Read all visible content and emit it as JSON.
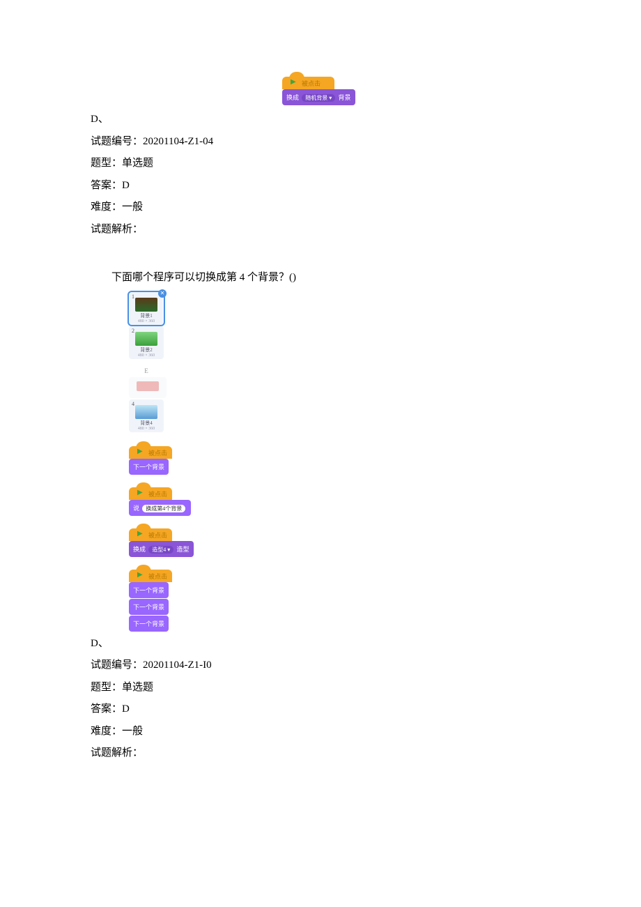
{
  "q1": {
    "block_d_hat_flag": "▶",
    "block_d_hat_text": "被点击",
    "block_d_body": "换成",
    "block_d_dd": "随机背景 ▾",
    "block_d_suffix": "背景",
    "option_d_label": "D、",
    "id_label": "试题编号：",
    "id_value": "20201104-Z1-04",
    "type_label": "题型：",
    "type_value": "单选题",
    "answer_label": "答案：",
    "answer_value": "D",
    "difficulty_label": "难度：",
    "difficulty_value": "一般",
    "analysis_label": "试题解析：",
    "analysis_value": ""
  },
  "q2": {
    "question_text": "下面哪个程序可以切换成第 4 个背景？()",
    "bd": {
      "item1_num": "1",
      "item1_label": "背景1",
      "item1_size": "480 × 360",
      "item2_num": "2",
      "item2_label": "背景2",
      "item2_size": "480 × 360",
      "col2_header": "E",
      "item4_num": "4",
      "item4_label": "背景4",
      "item4_size": "480 × 360"
    },
    "opt_a": {
      "hat_flag": "▶",
      "hat_text": "被点击",
      "body": "下一个背景"
    },
    "opt_b": {
      "hat_flag": "▶",
      "hat_text": "被点击",
      "body_pre": "说",
      "body_pill": "换成第4个背景"
    },
    "opt_c": {
      "hat_flag": "▶",
      "hat_text": "被点击",
      "body_pre": "换成",
      "body_dd": "造型4 ▾",
      "body_suf": "造型"
    },
    "opt_d": {
      "hat_flag": "▶",
      "hat_text": "被点击",
      "body1": "下一个背景",
      "body2": "下一个背景",
      "body3": "下一个背景"
    },
    "option_d_label": "D、",
    "id_label": "试题编号：",
    "id_value": "20201104-Z1-I0",
    "type_label": "题型：",
    "type_value": "单选题",
    "answer_label": "答案：",
    "answer_value": "D",
    "difficulty_label": "难度：",
    "difficulty_value": "一般",
    "analysis_label": "试题解析：",
    "analysis_value": ""
  }
}
